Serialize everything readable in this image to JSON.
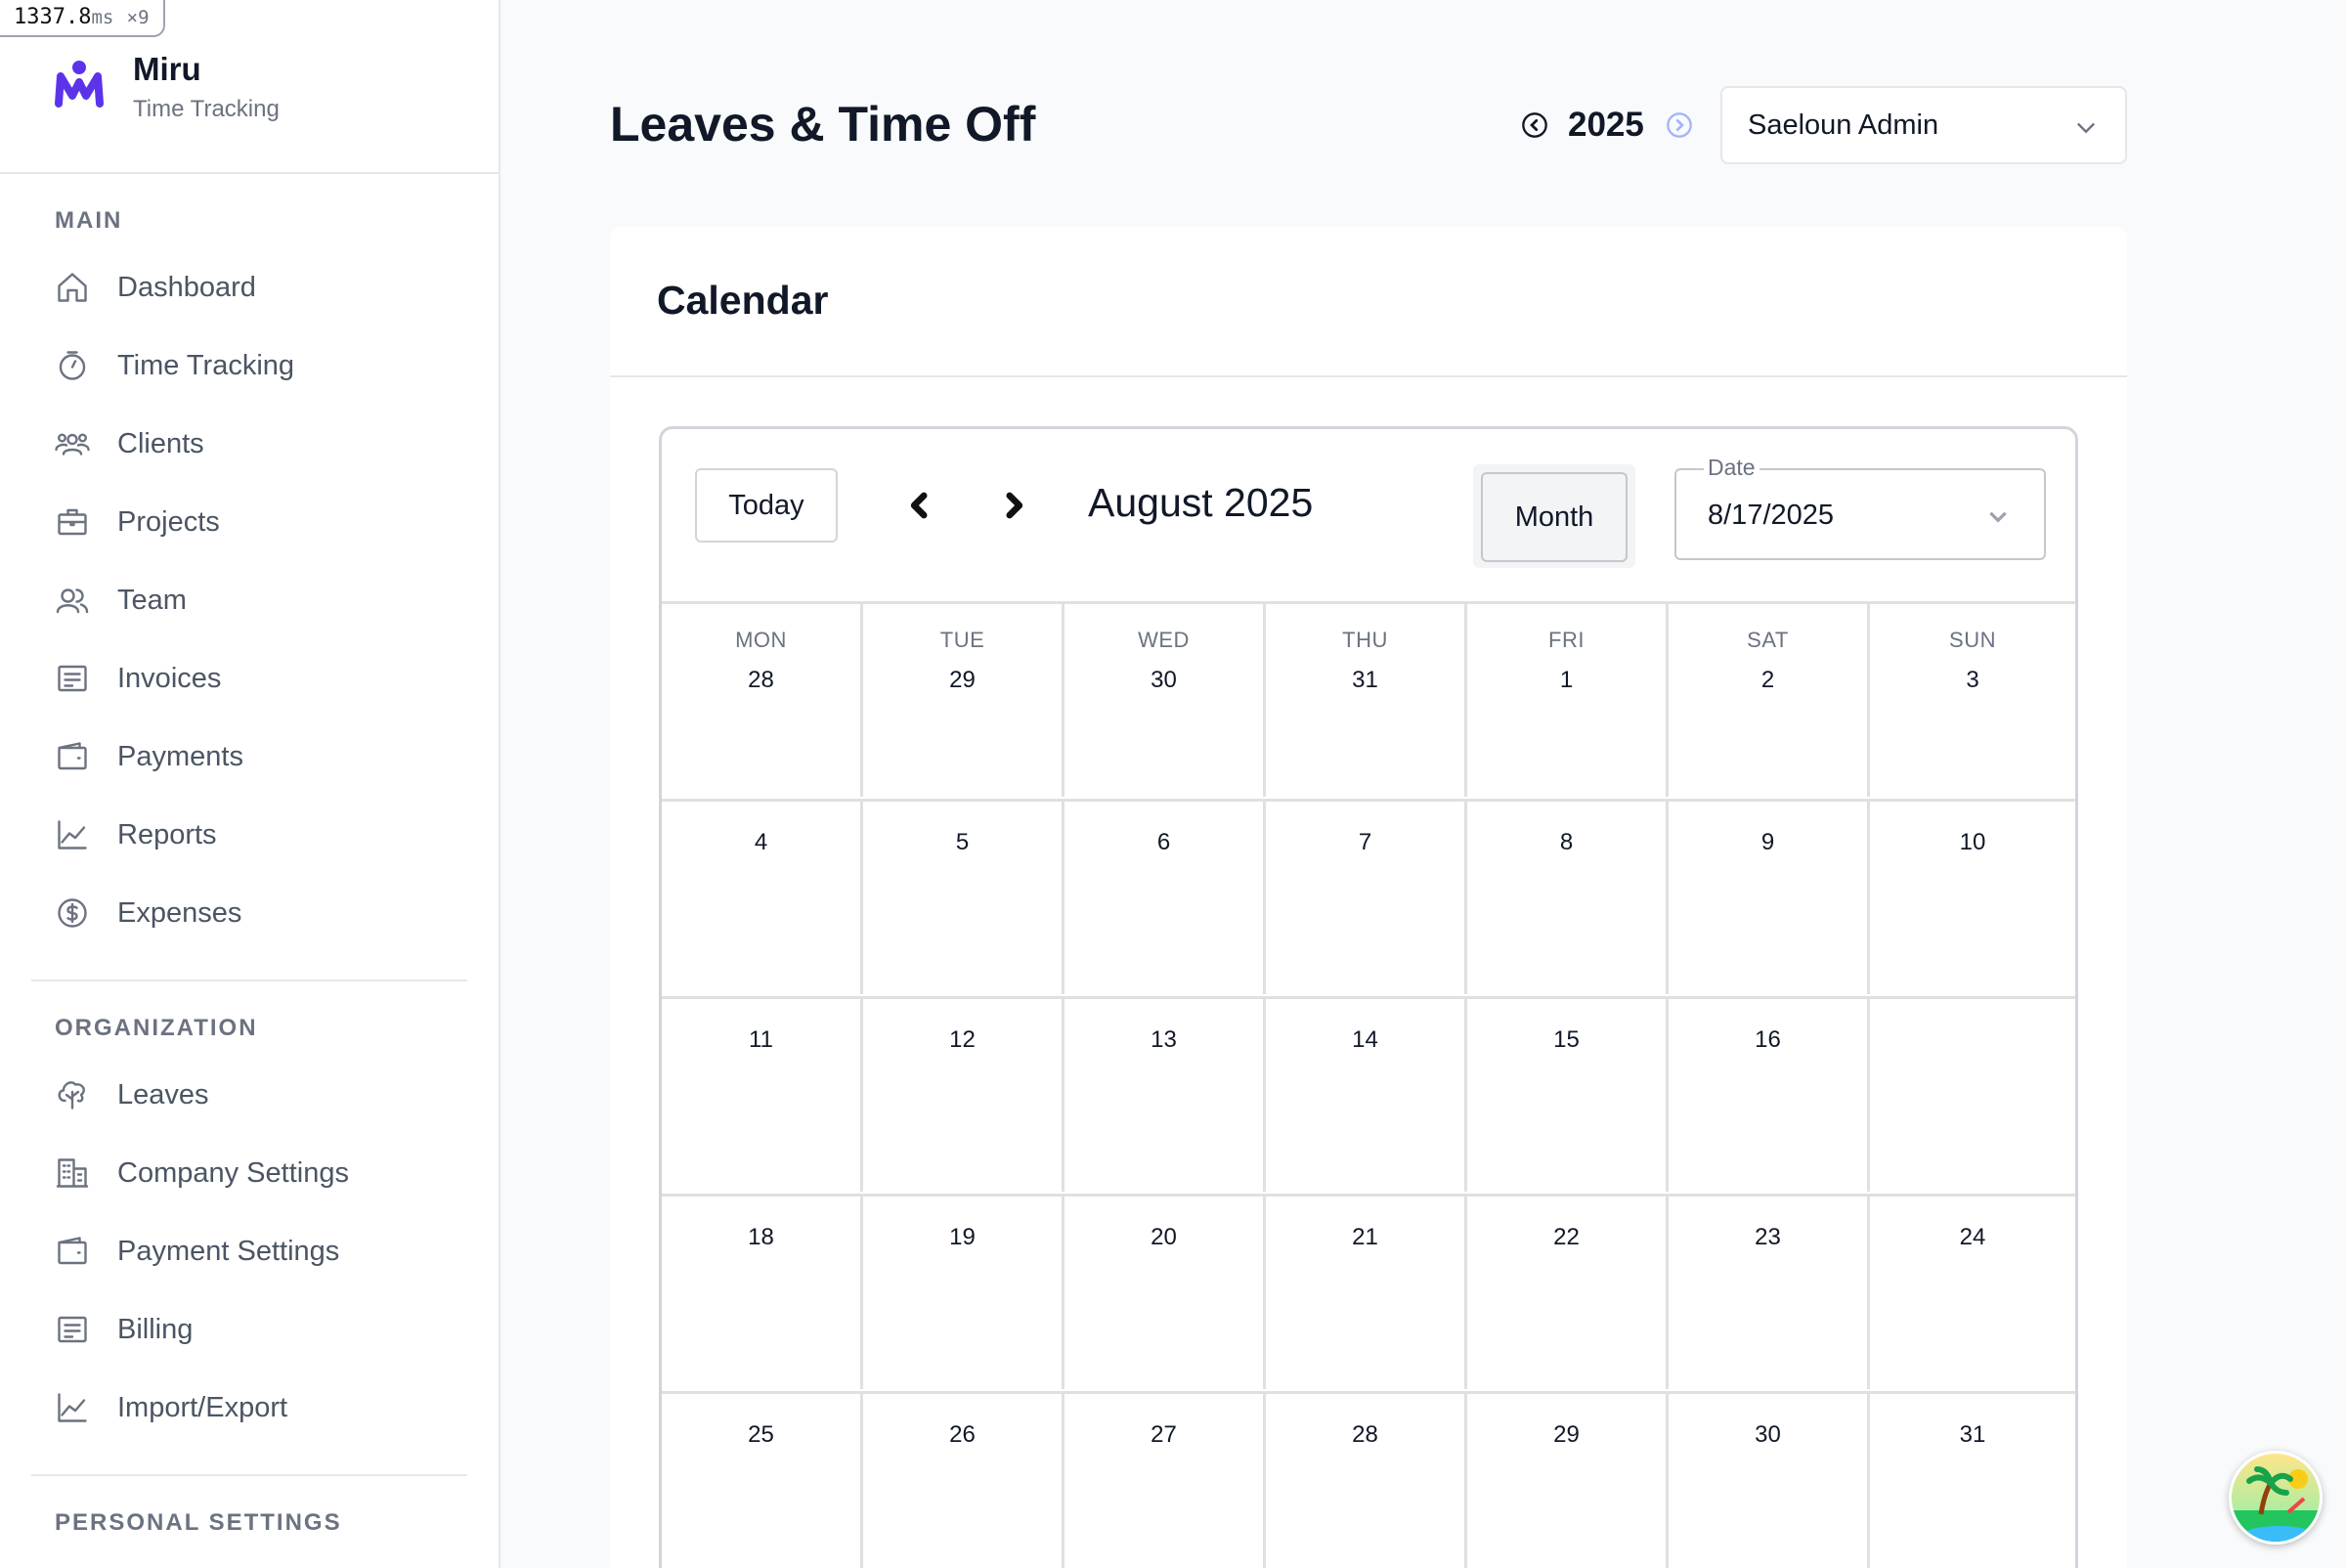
{
  "perf": {
    "value": "1337.8",
    "unit": "ms",
    "count": "×9"
  },
  "brand": {
    "name": "Miru",
    "subtitle": "Time Tracking"
  },
  "sidebar": {
    "sections": [
      {
        "title": "MAIN",
        "items": [
          {
            "label": "Dashboard",
            "icon": "home-icon"
          },
          {
            "label": "Time Tracking",
            "icon": "stopwatch-icon"
          },
          {
            "label": "Clients",
            "icon": "clients-icon"
          },
          {
            "label": "Projects",
            "icon": "briefcase-icon"
          },
          {
            "label": "Team",
            "icon": "team-icon"
          },
          {
            "label": "Invoices",
            "icon": "invoice-icon"
          },
          {
            "label": "Payments",
            "icon": "wallet-icon"
          },
          {
            "label": "Reports",
            "icon": "chart-icon"
          },
          {
            "label": "Expenses",
            "icon": "dollar-icon"
          }
        ]
      },
      {
        "title": "ORGANIZATION",
        "items": [
          {
            "label": "Leaves",
            "icon": "tree-icon"
          },
          {
            "label": "Company Settings",
            "icon": "building-icon"
          },
          {
            "label": "Payment Settings",
            "icon": "wallet-icon"
          },
          {
            "label": "Billing",
            "icon": "invoice-icon"
          },
          {
            "label": "Import/Export",
            "icon": "chart-icon"
          }
        ]
      },
      {
        "title": "PERSONAL SETTINGS",
        "items": []
      }
    ]
  },
  "header": {
    "title": "Leaves & Time Off",
    "year": "2025",
    "user": "Saeloun Admin"
  },
  "card": {
    "title": "Calendar"
  },
  "calendar": {
    "today_label": "Today",
    "month_label": "August 2025",
    "view_label": "Month",
    "date_legend": "Date",
    "date_value": "8/17/2025",
    "weekdays": [
      "MON",
      "TUE",
      "WED",
      "THU",
      "FRI",
      "SAT",
      "SUN"
    ],
    "weeks": [
      [
        "28",
        "29",
        "30",
        "31",
        "1",
        "2",
        "3"
      ],
      [
        "4",
        "5",
        "6",
        "7",
        "8",
        "9",
        "10"
      ],
      [
        "11",
        "12",
        "13",
        "14",
        "15",
        "16",
        ""
      ],
      [
        "18",
        "19",
        "20",
        "21",
        "22",
        "23",
        "24"
      ],
      [
        "25",
        "26",
        "27",
        "28",
        "29",
        "30",
        "31"
      ]
    ]
  },
  "colors": {
    "brand": "#5b34ea",
    "text": "#111827",
    "muted": "#6b7280",
    "border": "#e5e7eb"
  }
}
